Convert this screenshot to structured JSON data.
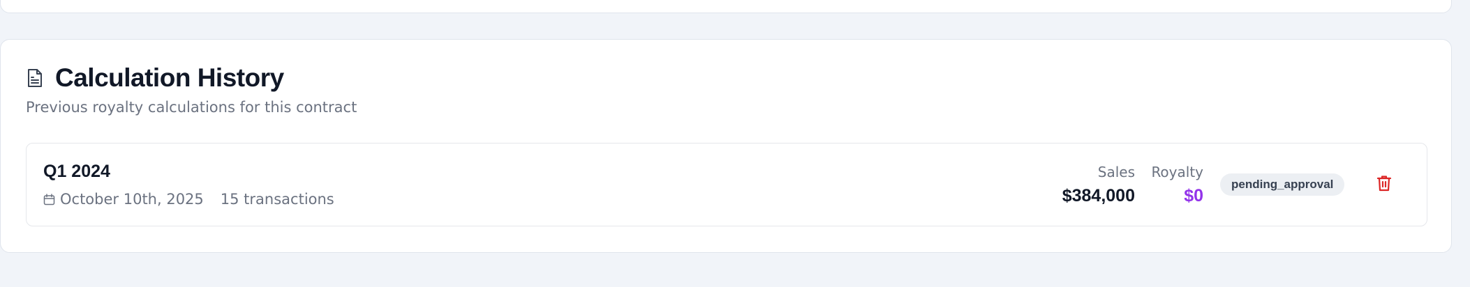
{
  "card": {
    "title": "Calculation History",
    "subtitle": "Previous royalty calculations for this contract",
    "title_icon": "document-icon"
  },
  "calculations": [
    {
      "period": "Q1 2024",
      "date": "October 10th, 2025",
      "transactions": "15 transactions",
      "sales_label": "Sales",
      "sales_value": "$384,000",
      "royalty_label": "Royalty",
      "royalty_value": "$0",
      "status": "pending_approval",
      "date_icon": "calendar-icon",
      "delete_icon": "trash-icon"
    }
  ],
  "colors": {
    "background": "#f1f4f9",
    "card": "#ffffff",
    "royalty": "#9333ea",
    "delete": "#dc2626",
    "badge_bg": "#eceff3"
  }
}
